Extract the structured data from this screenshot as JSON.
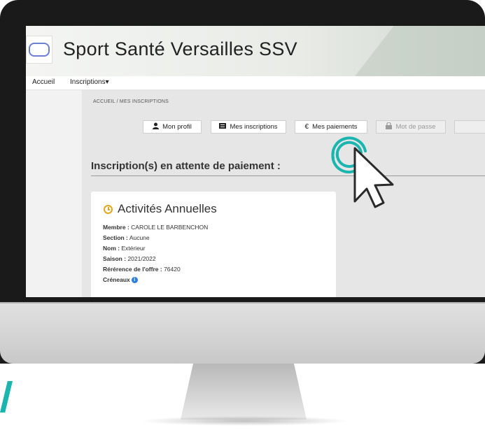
{
  "site": {
    "title": "Sport Santé Versailles SSV"
  },
  "nav": {
    "home": "Accueil",
    "inscriptions": "Inscriptions",
    "caret": "▾"
  },
  "breadcrumb": {
    "text": "ACCUEIL  /  MES INSCRIPTIONS"
  },
  "toolbar": {
    "profile": {
      "label": "Mon profil",
      "icon": "user-icon"
    },
    "inscriptions": {
      "label": "Mes inscriptions",
      "icon": "list-icon"
    },
    "payments": {
      "label": "Mes paiements",
      "icon": "euro-icon",
      "glyph": "€"
    },
    "password": {
      "label": "Mot de passe",
      "icon": "lock-icon"
    }
  },
  "section": {
    "title": "Inscription(s) en attente de paiement :"
  },
  "card": {
    "title": "Activités Annuelles",
    "fields": [
      {
        "label": "Membre :",
        "value": "CAROLE LE BARBENCHON"
      },
      {
        "label": "Section :",
        "value": "Aucune"
      },
      {
        "label": "Nom :",
        "value": "Extérieur"
      },
      {
        "label": "Saison :",
        "value": "2021/2022"
      },
      {
        "label": "Rérérence de l'offre :",
        "value": "76420"
      },
      {
        "label": "Créneaux",
        "value": ""
      }
    ]
  },
  "colors": {
    "accent_teal": "#1bb5b0",
    "clock": "#e3a71e",
    "info": "#2a7de1"
  }
}
